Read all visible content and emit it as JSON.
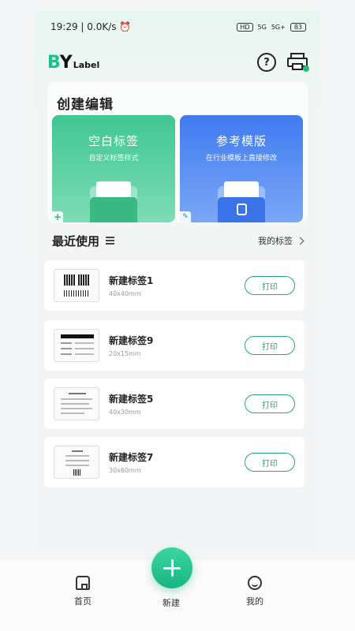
{
  "status_bar": {
    "time": "19:29",
    "speed": "0.0K/s",
    "hd": "HD",
    "signal1": "5G",
    "signal2": "5G+",
    "battery": "83"
  },
  "app": {
    "logo_b": "B",
    "logo_y": "Y",
    "logo_label": "Label",
    "help_glyph": "?"
  },
  "create": {
    "title": "创建编辑",
    "blank": {
      "title": "空白标签",
      "subtitle": "自定义标签样式"
    },
    "template": {
      "title": "参考模版",
      "subtitle": "在行业模板上直接修改"
    }
  },
  "recent": {
    "title": "最近使用",
    "my_labels": "我的标签"
  },
  "labels": [
    {
      "name": "新建标签1",
      "size": "40x40mm",
      "print": "打印"
    },
    {
      "name": "新建标签9",
      "size": "20x15mm",
      "print": "打印"
    },
    {
      "name": "新建标签5",
      "size": "40x30mm",
      "print": "打印"
    },
    {
      "name": "新建标签7",
      "size": "30x60mm",
      "print": "打印"
    }
  ],
  "nav": {
    "home": "首页",
    "new": "新建",
    "mine": "我的"
  }
}
